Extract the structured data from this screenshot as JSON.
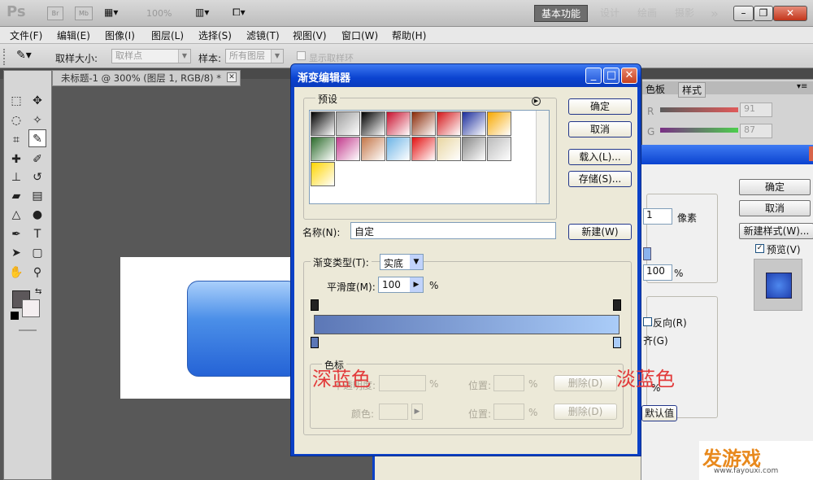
{
  "app": {
    "logo": "Ps",
    "mini_br": "Br",
    "mini_mb": "Mb",
    "zoom": "100%",
    "workspaces": [
      "基本功能",
      "设计",
      "绘画",
      "摄影"
    ],
    "more": "»"
  },
  "menu": [
    "文件(F)",
    "编辑(E)",
    "图像(I)",
    "图层(L)",
    "选择(S)",
    "滤镜(T)",
    "视图(V)",
    "窗口(W)",
    "帮助(H)"
  ],
  "options": {
    "sample_size_label": "取样大小:",
    "sample_size_value": "取样点",
    "sample_label": "样本:",
    "sample_value": "所有图层",
    "show_ring": "显示取样环"
  },
  "document": {
    "tab": "未标题-1 @ 300% (图层 1, RGB/8) *"
  },
  "right_panel": {
    "tabs": [
      "色板",
      "样式"
    ],
    "r_label": "R",
    "r_value": "91",
    "g_label": "G",
    "g_value": "87"
  },
  "style_dialog": {
    "ok": "确定",
    "cancel": "取消",
    "new_style": "新建样式(W)...",
    "preview": "预览(V)",
    "size_value": "1",
    "size_unit": "像素",
    "pct_value": "100",
    "pct_unit": "%",
    "reverse": "反向(R)",
    "align": "齐(G)",
    "default": "默认值",
    "pct2": "%"
  },
  "gradient_editor": {
    "title": "渐变编辑器",
    "presets_label": "预设",
    "ok": "确定",
    "cancel": "取消",
    "load": "载入(L)...",
    "save": "存储(S)...",
    "name_label": "名称(N):",
    "name_value": "自定",
    "new_button": "新建(W)",
    "type_label": "渐变类型(T):",
    "type_value": "实底",
    "smooth_label": "平滑度(M):",
    "smooth_value": "100",
    "smooth_unit": "%",
    "stops_label": "色标",
    "opacity_label": "不透明度:",
    "location_label": "位置:",
    "delete_label": "删除(D)",
    "color_label": "颜色:",
    "pct": "%",
    "start_color": "#5c77b6",
    "end_color": "#aaccf8",
    "presets": [
      [
        "#000000",
        "#9d9d9d",
        "#000000",
        "#c8102e",
        "#8b2b08",
        "#d4171a",
        "#1b2d9c",
        "#f7a800"
      ],
      [
        "#2b6a2a",
        "#c23a8c",
        "#c47648",
        "#6db4e6",
        "#e31010",
        "#e8d5a0",
        "#888888",
        "#bbbbbb"
      ],
      [
        "#ffd500"
      ]
    ]
  },
  "annotations": {
    "dark_blue": "深蓝色",
    "light_blue": "淡蓝色"
  },
  "watermark": {
    "brand": "发游戏",
    "url": "www.fayouxi.com"
  }
}
